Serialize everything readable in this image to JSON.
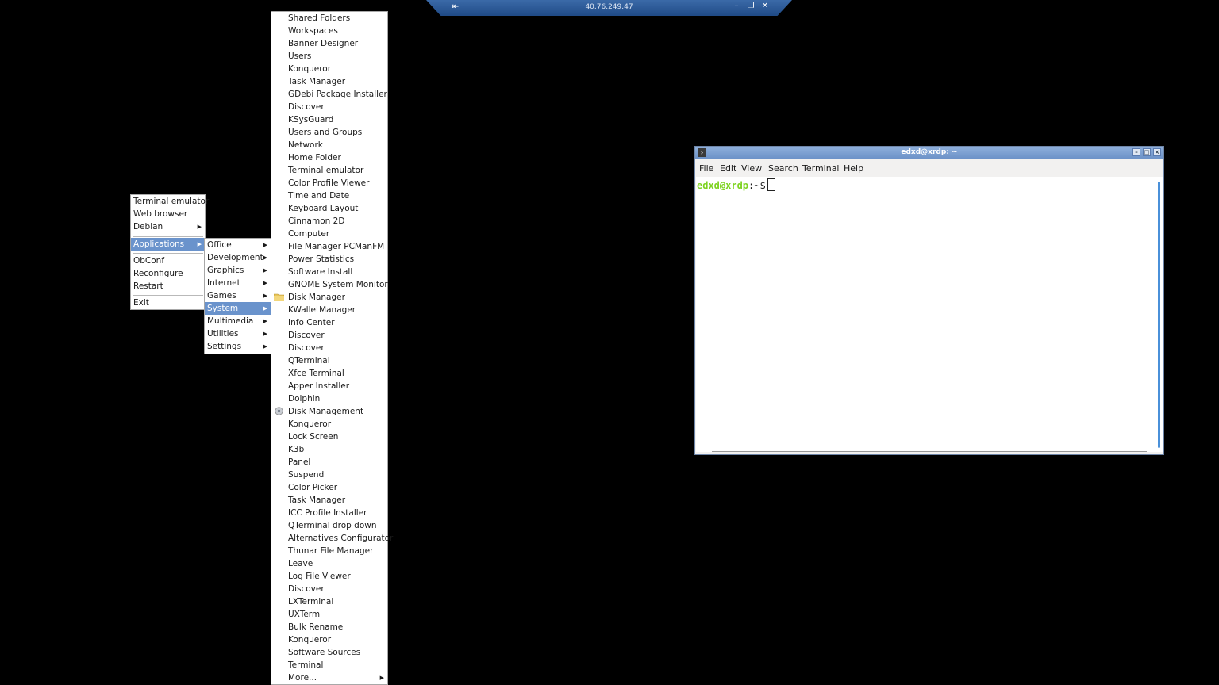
{
  "rdp_bar": {
    "host": "40.76.249.47"
  },
  "root_menu": {
    "group1": [
      "Terminal emulator",
      "Web browser",
      "Debian"
    ],
    "applications": "Applications",
    "group2": [
      "ObConf",
      "Reconfigure",
      "Restart"
    ],
    "exit": "Exit"
  },
  "apps_menu": {
    "items": [
      "Office",
      "Development",
      "Graphics",
      "Internet",
      "Games",
      "System",
      "Multimedia",
      "Utilities",
      "Settings"
    ],
    "selected": "System"
  },
  "system_menu": {
    "items": [
      "Shared Folders",
      "Workspaces",
      "Banner Designer",
      "Users",
      "Konqueror",
      "Task Manager",
      "GDebi Package Installer",
      "Discover",
      "KSysGuard",
      "Users and Groups",
      "Network",
      "Home Folder",
      "Terminal emulator",
      "Color Profile Viewer",
      "Time and Date",
      "Keyboard Layout",
      "Cinnamon 2D",
      "Computer",
      "File Manager PCManFM",
      "Power Statistics",
      "Software Install",
      "GNOME System Monitor",
      "Disk Manager",
      "KWalletManager",
      "Info Center",
      "Discover",
      "Discover",
      "QTerminal",
      "Xfce Terminal",
      "Apper Installer",
      "Dolphin",
      "Disk Management",
      "Konqueror",
      "Lock Screen",
      "K3b",
      "Panel",
      "Suspend",
      "Color Picker",
      "Task Manager",
      "ICC Profile Installer",
      "QTerminal drop down",
      "Alternatives Configurator",
      "Thunar File Manager",
      "Leave",
      "Log File Viewer",
      "Discover",
      "LXTerminal",
      "UXTerm",
      "Bulk Rename",
      "Konqueror",
      "Software Sources",
      "Terminal",
      "More..."
    ]
  },
  "terminal": {
    "title": "edxd@xrdp: ~",
    "menus": [
      "File",
      "Edit",
      "View",
      "Search",
      "Terminal",
      "Help"
    ],
    "prompt_user": "edxd@xrdp",
    "prompt_rest": ":~$"
  }
}
